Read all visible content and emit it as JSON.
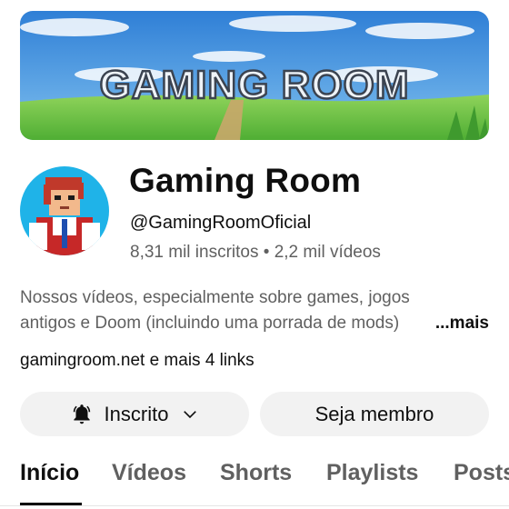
{
  "banner": {
    "title": "GAMING ROOM"
  },
  "channel": {
    "name": "Gaming Room",
    "handle": "@GamingRoomOficial",
    "stats": "8,31 mil inscritos • 2,2 mil vídeos",
    "description_line1": "Nossos vídeos, especialmente sobre games, jogos",
    "description_line2": "antigos e Doom (incluindo uma porrada de mods)",
    "more_label": "...mais",
    "link_domain": "gamingroom.net",
    "link_rest": " e mais 4 links"
  },
  "buttons": {
    "subscribed_label": "Inscrito",
    "member_label": "Seja membro"
  },
  "tabs": [
    {
      "label": "Início"
    },
    {
      "label": "Vídeos"
    },
    {
      "label": "Shorts"
    },
    {
      "label": "Playlists"
    },
    {
      "label": "Posts"
    }
  ],
  "icons": {
    "bell": "bell-icon",
    "chevron": "chevron-down-icon"
  },
  "colors": {
    "text": "#0f0f0f",
    "secondary": "#606060",
    "button_bg": "#f2f2f2",
    "sky": "#3d8ee0",
    "grass": "#6cc34a"
  }
}
